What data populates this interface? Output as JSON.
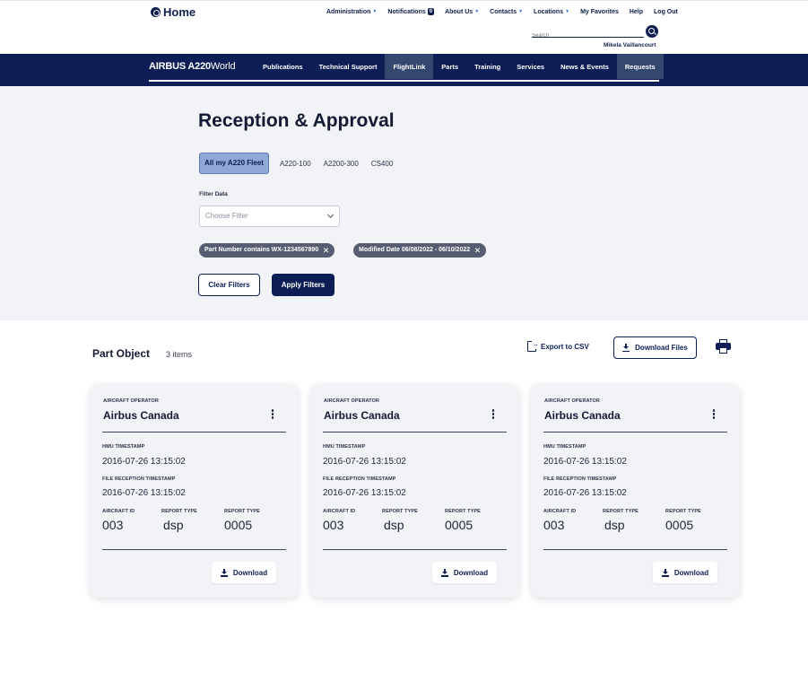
{
  "header": {
    "home_label": "Home",
    "util_nav": [
      {
        "label": "Administration",
        "dropdown": true
      },
      {
        "label": "Notifications",
        "badge": "0"
      },
      {
        "label": "About Us",
        "dropdown": true
      },
      {
        "label": "Contacts",
        "dropdown": true
      },
      {
        "label": "Locations",
        "dropdown": true
      },
      {
        "label": "My Favorites"
      },
      {
        "label": "Help"
      },
      {
        "label": "Log Out"
      }
    ],
    "search_placeholder": "Search",
    "user_name": "Mikela Vaillancourt",
    "icons": {
      "search": "search-icon",
      "home": "home-icon"
    }
  },
  "mainnav": {
    "brand_bold": "AIRBUS A220",
    "brand_thin": "World",
    "items": [
      {
        "label": "Publications",
        "active": false
      },
      {
        "label": "Technical Support",
        "active": false
      },
      {
        "label": "FlightLink",
        "active": true
      },
      {
        "label": "Parts",
        "active": false
      },
      {
        "label": "Training",
        "active": false
      },
      {
        "label": "Services",
        "active": false
      },
      {
        "label": "News & Events",
        "active": false
      },
      {
        "label": "Requests",
        "active": true
      }
    ],
    "colors": {
      "bar": "#0c1e55",
      "active_item": "#34486f"
    }
  },
  "filters": {
    "page_title": "Reception & Approval",
    "fleet_tabs": [
      {
        "label": "All my A220 Fleet",
        "selected": true
      },
      {
        "label": "A220-100",
        "selected": false
      },
      {
        "label": "A2200-300",
        "selected": false
      },
      {
        "label": "CS400",
        "selected": false
      }
    ],
    "filter_label": "Filter Data",
    "filter_placeholder": "Choose Filter",
    "chips": [
      {
        "label": "Part Number contains WX-1234567890"
      },
      {
        "label": "Modified Date 06/08/2022 - 06/10/2022"
      }
    ],
    "clear_label": "Clear Filters",
    "apply_label": "Apply Filters"
  },
  "results": {
    "title": "Part Object",
    "count": "3 items",
    "export_label": "Export to CSV",
    "download_files_label": "Download Files",
    "icons": {
      "export": "export-icon",
      "download": "download-icon",
      "print": "printer-icon"
    }
  },
  "card_labels": {
    "operator": "AIRCRAFT OPERATOR",
    "hmu": "HMU TIMESTAMP",
    "reception": "FILE RECEPTION TIMESTAMP",
    "aircraft_id": "AIRCRAFT ID",
    "report_type_1": "REPORT TYPE",
    "report_type_2": "REPORT TYPE",
    "download": "Download"
  },
  "cards": [
    {
      "operator": "Airbus Canada",
      "hmu_timestamp": "2016-07-26 13:15:02",
      "reception_timestamp": "2016-07-26 13:15:02",
      "aircraft_id": "003",
      "report_type_1": "dsp",
      "report_type_2": "0005"
    },
    {
      "operator": "Airbus Canada",
      "hmu_timestamp": "2016-07-26 13:15:02",
      "reception_timestamp": "2016-07-26 13:15:02",
      "aircraft_id": "003",
      "report_type_1": "dsp",
      "report_type_2": "0005"
    },
    {
      "operator": "Airbus Canada",
      "hmu_timestamp": "2016-07-26 13:15:02",
      "reception_timestamp": "2016-07-26 13:15:02",
      "aircraft_id": "003",
      "report_type_1": "dsp",
      "report_type_2": "0005"
    }
  ]
}
